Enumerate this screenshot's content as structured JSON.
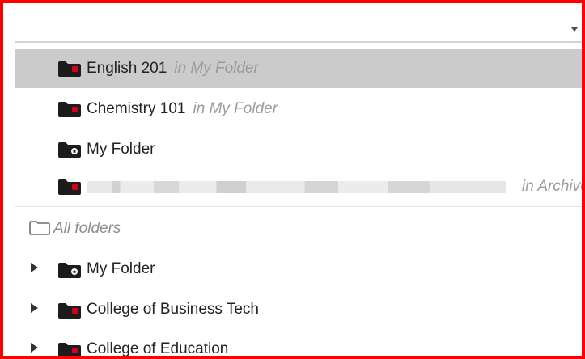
{
  "dropdown": {
    "selected_value": "",
    "arrow_icon": "caret-down-icon"
  },
  "recent": [
    {
      "name": "English 201",
      "location": "in My Folder",
      "icon": "shared-folder-icon",
      "selected": true
    },
    {
      "name": "Chemistry 101",
      "location": "in My Folder",
      "icon": "shared-folder-icon",
      "selected": false
    },
    {
      "name": "My Folder",
      "location": "",
      "icon": "personal-folder-icon",
      "selected": false
    },
    {
      "name": "",
      "location": "in Archive",
      "icon": "shared-folder-icon",
      "selected": false,
      "redacted": true
    }
  ],
  "all_folders": {
    "label": "All folders",
    "icon": "folder-outline-icon"
  },
  "tree": [
    {
      "name": "My Folder",
      "icon": "personal-folder-icon"
    },
    {
      "name": "College of Business Tech",
      "icon": "shared-folder-icon"
    },
    {
      "name": "College of Education",
      "icon": "shared-folder-icon"
    }
  ],
  "colors": {
    "border": "#ff0000",
    "selected_bg": "#cbcbcb",
    "folder": "#1c1c1c",
    "folder_badge": "#d4001b",
    "muted_text": "#9a9a9a"
  }
}
